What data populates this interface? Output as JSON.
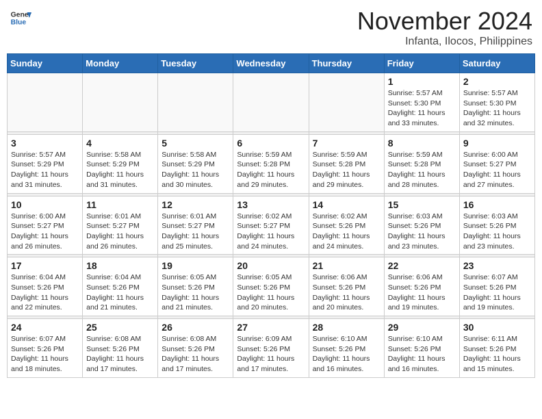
{
  "header": {
    "logo_general": "General",
    "logo_blue": "Blue",
    "month_title": "November 2024",
    "location": "Infanta, Ilocos, Philippines"
  },
  "calendar": {
    "weekdays": [
      "Sunday",
      "Monday",
      "Tuesday",
      "Wednesday",
      "Thursday",
      "Friday",
      "Saturday"
    ],
    "weeks": [
      [
        {
          "day": "",
          "info": ""
        },
        {
          "day": "",
          "info": ""
        },
        {
          "day": "",
          "info": ""
        },
        {
          "day": "",
          "info": ""
        },
        {
          "day": "",
          "info": ""
        },
        {
          "day": "1",
          "info": "Sunrise: 5:57 AM\nSunset: 5:30 PM\nDaylight: 11 hours\nand 33 minutes."
        },
        {
          "day": "2",
          "info": "Sunrise: 5:57 AM\nSunset: 5:30 PM\nDaylight: 11 hours\nand 32 minutes."
        }
      ],
      [
        {
          "day": "3",
          "info": "Sunrise: 5:57 AM\nSunset: 5:29 PM\nDaylight: 11 hours\nand 31 minutes."
        },
        {
          "day": "4",
          "info": "Sunrise: 5:58 AM\nSunset: 5:29 PM\nDaylight: 11 hours\nand 31 minutes."
        },
        {
          "day": "5",
          "info": "Sunrise: 5:58 AM\nSunset: 5:29 PM\nDaylight: 11 hours\nand 30 minutes."
        },
        {
          "day": "6",
          "info": "Sunrise: 5:59 AM\nSunset: 5:28 PM\nDaylight: 11 hours\nand 29 minutes."
        },
        {
          "day": "7",
          "info": "Sunrise: 5:59 AM\nSunset: 5:28 PM\nDaylight: 11 hours\nand 29 minutes."
        },
        {
          "day": "8",
          "info": "Sunrise: 5:59 AM\nSunset: 5:28 PM\nDaylight: 11 hours\nand 28 minutes."
        },
        {
          "day": "9",
          "info": "Sunrise: 6:00 AM\nSunset: 5:27 PM\nDaylight: 11 hours\nand 27 minutes."
        }
      ],
      [
        {
          "day": "10",
          "info": "Sunrise: 6:00 AM\nSunset: 5:27 PM\nDaylight: 11 hours\nand 26 minutes."
        },
        {
          "day": "11",
          "info": "Sunrise: 6:01 AM\nSunset: 5:27 PM\nDaylight: 11 hours\nand 26 minutes."
        },
        {
          "day": "12",
          "info": "Sunrise: 6:01 AM\nSunset: 5:27 PM\nDaylight: 11 hours\nand 25 minutes."
        },
        {
          "day": "13",
          "info": "Sunrise: 6:02 AM\nSunset: 5:27 PM\nDaylight: 11 hours\nand 24 minutes."
        },
        {
          "day": "14",
          "info": "Sunrise: 6:02 AM\nSunset: 5:26 PM\nDaylight: 11 hours\nand 24 minutes."
        },
        {
          "day": "15",
          "info": "Sunrise: 6:03 AM\nSunset: 5:26 PM\nDaylight: 11 hours\nand 23 minutes."
        },
        {
          "day": "16",
          "info": "Sunrise: 6:03 AM\nSunset: 5:26 PM\nDaylight: 11 hours\nand 23 minutes."
        }
      ],
      [
        {
          "day": "17",
          "info": "Sunrise: 6:04 AM\nSunset: 5:26 PM\nDaylight: 11 hours\nand 22 minutes."
        },
        {
          "day": "18",
          "info": "Sunrise: 6:04 AM\nSunset: 5:26 PM\nDaylight: 11 hours\nand 21 minutes."
        },
        {
          "day": "19",
          "info": "Sunrise: 6:05 AM\nSunset: 5:26 PM\nDaylight: 11 hours\nand 21 minutes."
        },
        {
          "day": "20",
          "info": "Sunrise: 6:05 AM\nSunset: 5:26 PM\nDaylight: 11 hours\nand 20 minutes."
        },
        {
          "day": "21",
          "info": "Sunrise: 6:06 AM\nSunset: 5:26 PM\nDaylight: 11 hours\nand 20 minutes."
        },
        {
          "day": "22",
          "info": "Sunrise: 6:06 AM\nSunset: 5:26 PM\nDaylight: 11 hours\nand 19 minutes."
        },
        {
          "day": "23",
          "info": "Sunrise: 6:07 AM\nSunset: 5:26 PM\nDaylight: 11 hours\nand 19 minutes."
        }
      ],
      [
        {
          "day": "24",
          "info": "Sunrise: 6:07 AM\nSunset: 5:26 PM\nDaylight: 11 hours\nand 18 minutes."
        },
        {
          "day": "25",
          "info": "Sunrise: 6:08 AM\nSunset: 5:26 PM\nDaylight: 11 hours\nand 17 minutes."
        },
        {
          "day": "26",
          "info": "Sunrise: 6:08 AM\nSunset: 5:26 PM\nDaylight: 11 hours\nand 17 minutes."
        },
        {
          "day": "27",
          "info": "Sunrise: 6:09 AM\nSunset: 5:26 PM\nDaylight: 11 hours\nand 17 minutes."
        },
        {
          "day": "28",
          "info": "Sunrise: 6:10 AM\nSunset: 5:26 PM\nDaylight: 11 hours\nand 16 minutes."
        },
        {
          "day": "29",
          "info": "Sunrise: 6:10 AM\nSunset: 5:26 PM\nDaylight: 11 hours\nand 16 minutes."
        },
        {
          "day": "30",
          "info": "Sunrise: 6:11 AM\nSunset: 5:26 PM\nDaylight: 11 hours\nand 15 minutes."
        }
      ]
    ]
  }
}
